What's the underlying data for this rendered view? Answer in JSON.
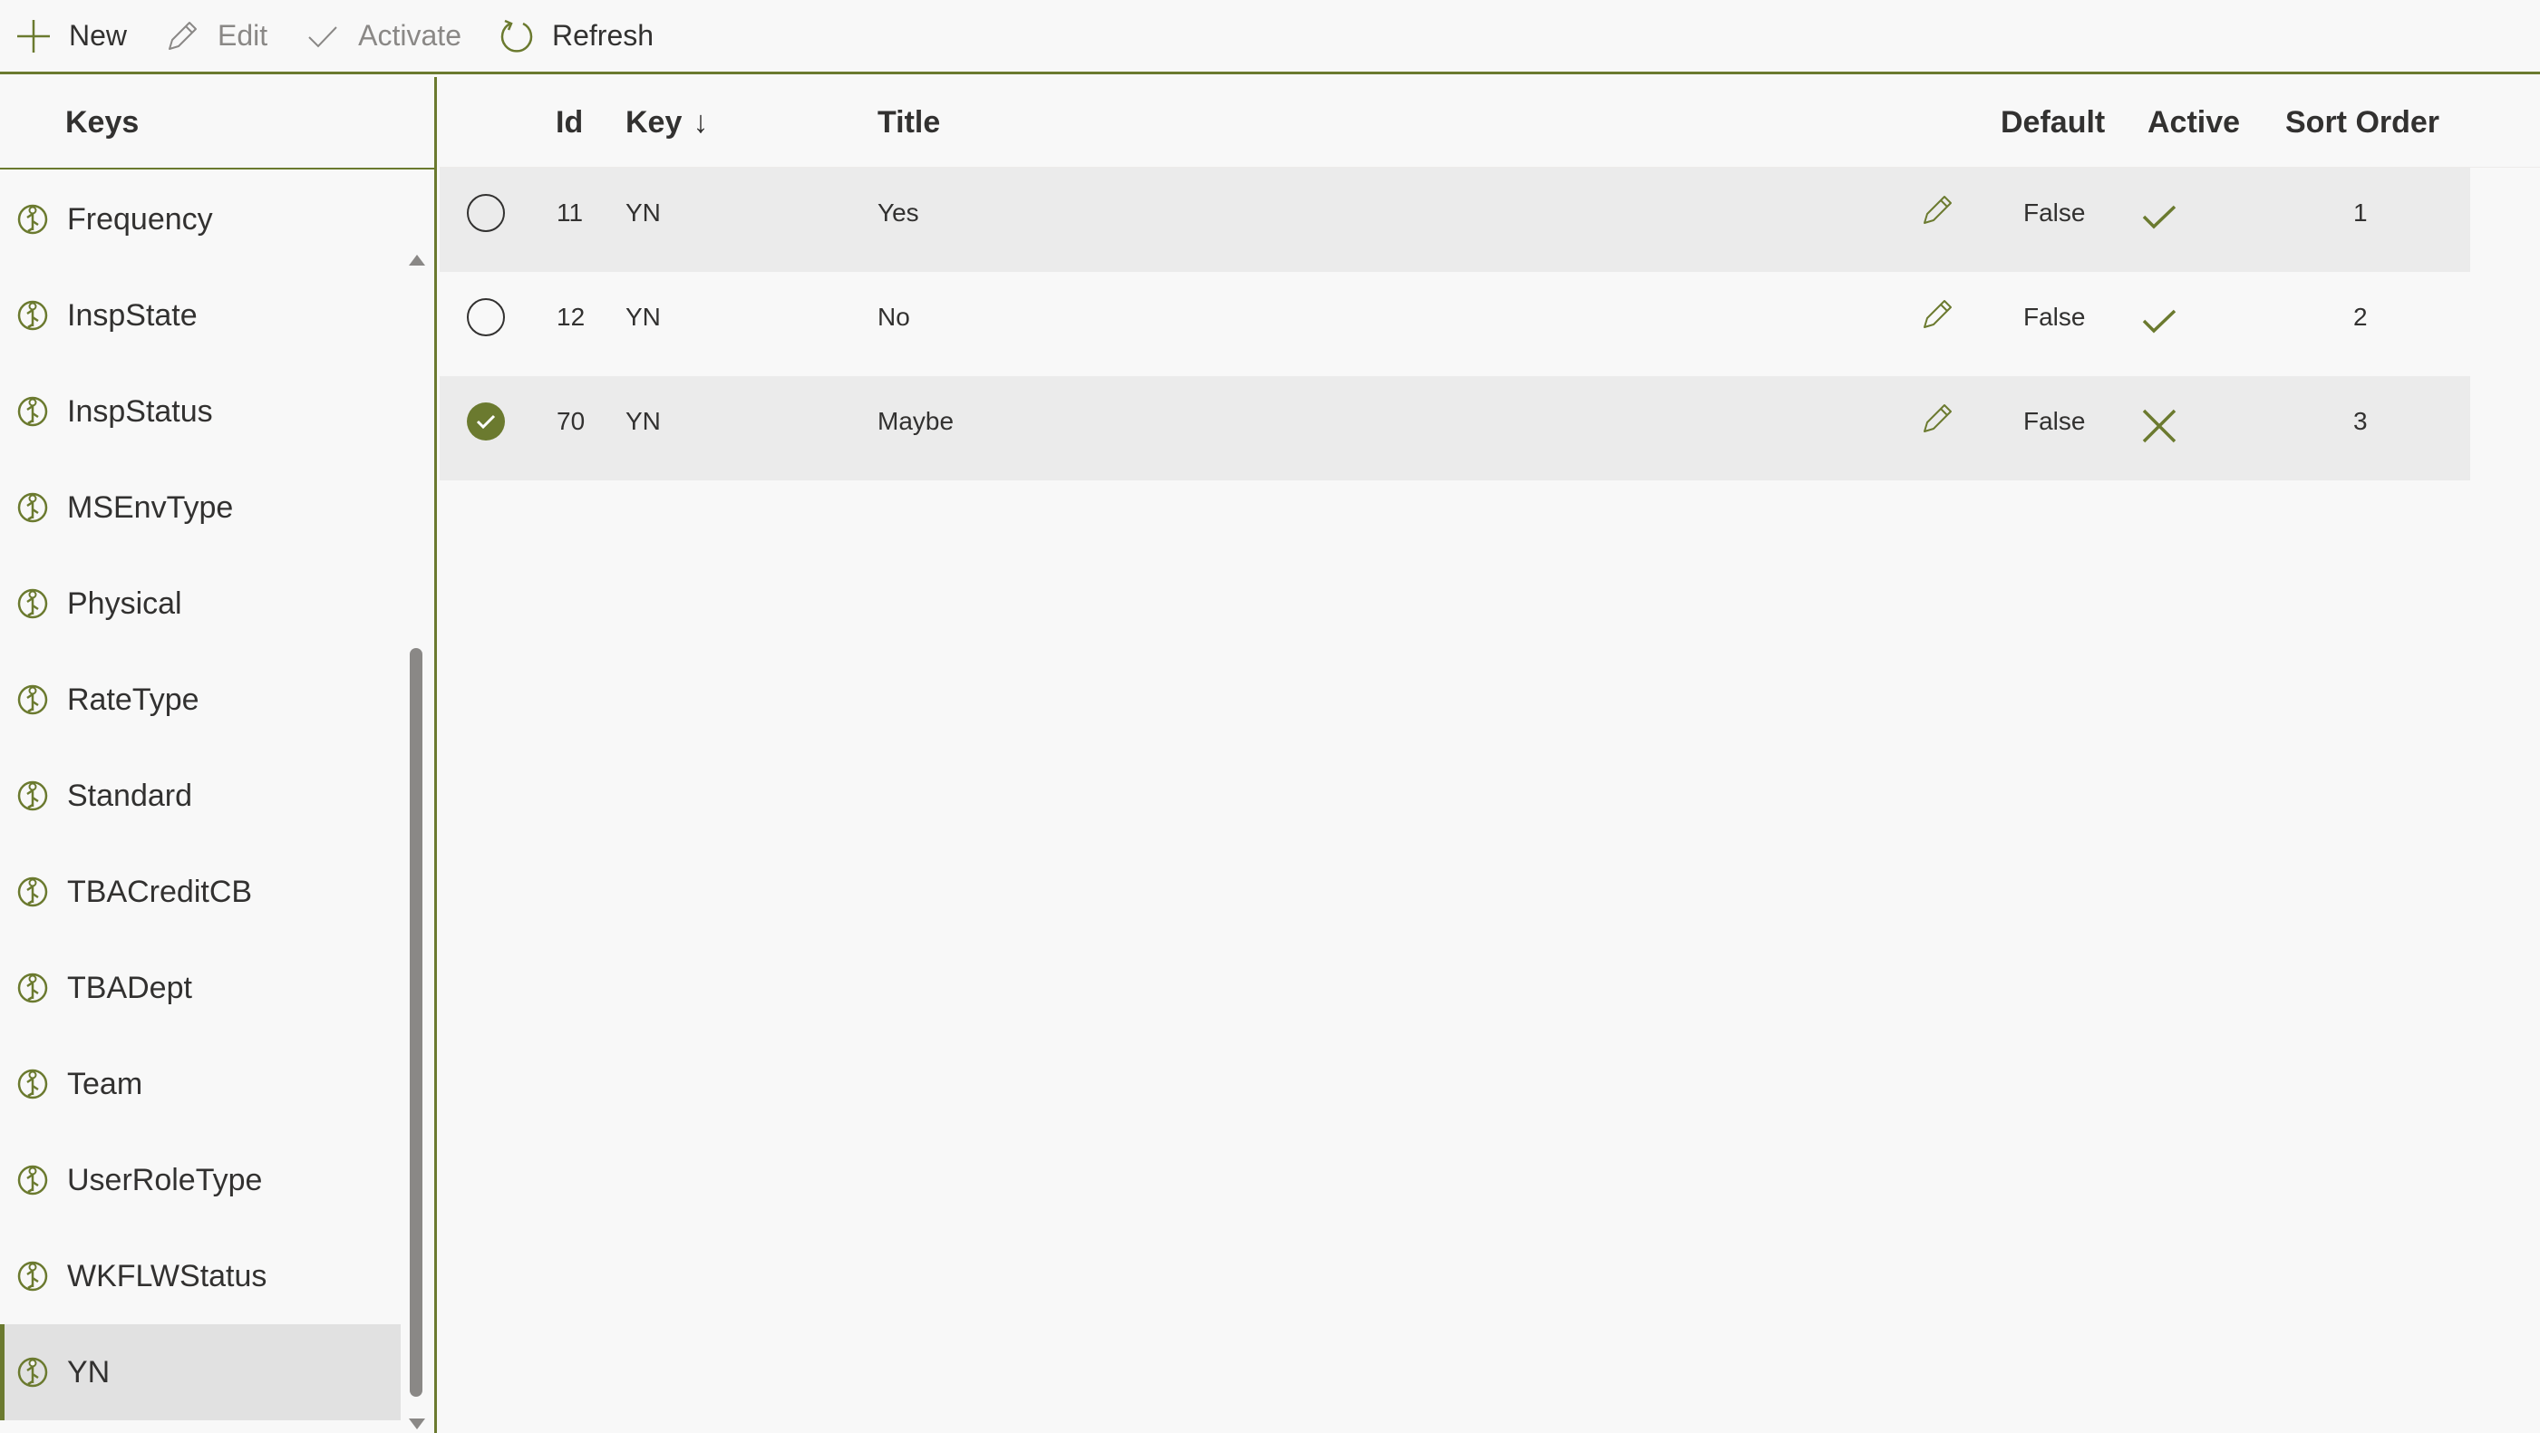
{
  "toolbar": {
    "new_label": "New",
    "edit_label": "Edit",
    "activate_label": "Activate",
    "refresh_label": "Refresh"
  },
  "sidebar": {
    "header": "Keys",
    "items": [
      {
        "label": "Frequency"
      },
      {
        "label": "InspState"
      },
      {
        "label": "InspStatus"
      },
      {
        "label": "MSEnvType"
      },
      {
        "label": "Physical"
      },
      {
        "label": "RateType"
      },
      {
        "label": "Standard"
      },
      {
        "label": "TBACreditCB"
      },
      {
        "label": "TBADept"
      },
      {
        "label": "Team"
      },
      {
        "label": "UserRoleType"
      },
      {
        "label": "WKFLWStatus"
      },
      {
        "label": "YN",
        "selected": true
      }
    ]
  },
  "grid": {
    "columns": {
      "id": "Id",
      "key": "Key",
      "sort_arrow": "↓",
      "title": "Title",
      "default": "Default",
      "active": "Active",
      "sort_order": "Sort Order"
    },
    "rows": [
      {
        "id": "11",
        "key": "YN",
        "title": "Yes",
        "default": "False",
        "active": true,
        "sort_order": "1",
        "selected": false
      },
      {
        "id": "12",
        "key": "YN",
        "title": "No",
        "default": "False",
        "active": true,
        "sort_order": "2",
        "selected": false
      },
      {
        "id": "70",
        "key": "YN",
        "title": "Maybe",
        "default": "False",
        "active": false,
        "sort_order": "3",
        "selected": true
      }
    ]
  },
  "colors": {
    "accent": "#6b7a2f",
    "disabled_text": "#8a8886",
    "selected_row": "#ebebeb",
    "selected_nav": "#e1e1e1"
  },
  "icons": {
    "new": "plus-icon",
    "edit": "pencil-icon",
    "activate": "check-icon",
    "refresh": "refresh-icon",
    "key": "key-icon",
    "active_true": "check-icon",
    "active_false": "x-icon"
  }
}
